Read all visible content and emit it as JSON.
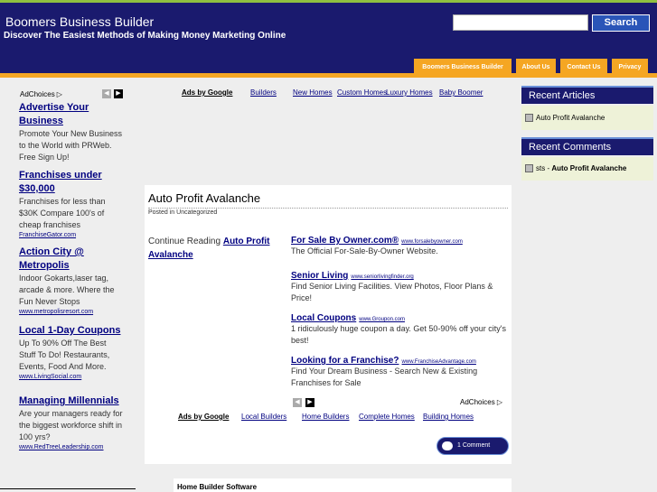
{
  "header": {
    "site_title": "Boomers Business Builder",
    "site_description": "Discover The Easiest Methods of Making Money Marketing Online",
    "search_placeholder": "",
    "search_button": "Search",
    "nav": [
      "Boomers Business Builder",
      "About Us",
      "Contact Us",
      "Privacy"
    ]
  },
  "left_ads": {
    "adchoices": "AdChoices",
    "items": [
      {
        "title": "Advertise Your Business",
        "desc": "Promote Your New Business to the World with PRWeb. Free Sign Up!",
        "url": ""
      },
      {
        "title": "Franchises under $30,000",
        "desc": "Franchises for less than $30K Compare 100's of cheap franchises",
        "url": "FranchiseGator.com"
      },
      {
        "title": "Action City @ Metropolis",
        "desc": "Indoor Gokarts,laser tag, arcade & more. Where the Fun Never Stops",
        "url": "www.metropolisresort.com"
      },
      {
        "title": "Local 1-Day Coupons",
        "desc": "Up To 90% Off The Best Stuff To Do! Restaurants, Events, Food And More.",
        "url": "www.LivingSocial.com"
      },
      {
        "title": "Managing Millennials",
        "desc": "Are your managers ready for the biggest workforce shift in 100 yrs?",
        "url": "www.RedTreeLeadership.com"
      }
    ]
  },
  "top_ads": {
    "label": "Ads by Google",
    "links": [
      "Builders",
      "New Homes",
      "Custom Homes",
      "Luxury Homes",
      "Baby Boomer"
    ]
  },
  "post": {
    "title": "Auto Profit Avalanche",
    "meta_prefix": "Posted in",
    "category": "Uncategorized",
    "continue_text": "Continue Reading",
    "continue_link": "Auto Profit Avalanche",
    "ads": [
      {
        "title": "For Sale By Owner.com®",
        "url": "www.forsalebyowner.com",
        "desc": "The Official For-Sale-By-Owner Website."
      },
      {
        "title": "Senior Living",
        "url": "www.seniorlivingfinder.org",
        "desc": "Find Senior Living Facilities. View Photos, Floor Plans & Price!"
      },
      {
        "title": "Local Coupons",
        "url": "www.Groupon.com",
        "desc": "1 ridiculously huge coupon a day. Get 50-90% off your city's best!"
      },
      {
        "title": "Looking for a Franchise?",
        "url": "www.FranchiseAdvantage.com",
        "desc": "Find Your Dream Business - Search New & Existing Franchises for Sale"
      }
    ],
    "adchoices": "AdChoices",
    "bottom_ads_label": "Ads by Google",
    "bottom_ads_links": [
      "Local Builders",
      "Home Builders",
      "Complete Homes",
      "Building Homes"
    ],
    "comment_button": "1 Comment"
  },
  "bottom_panel": {
    "title": "Home Builder Software"
  },
  "sidebar": {
    "recent_articles_title": "Recent Articles",
    "recent_articles": [
      "Auto Profit Avalanche"
    ],
    "recent_comments_title": "Recent Comments",
    "recent_comments": [
      {
        "author": "sts",
        "separator": " - ",
        "post": "Auto Profit Avalanche"
      }
    ]
  }
}
